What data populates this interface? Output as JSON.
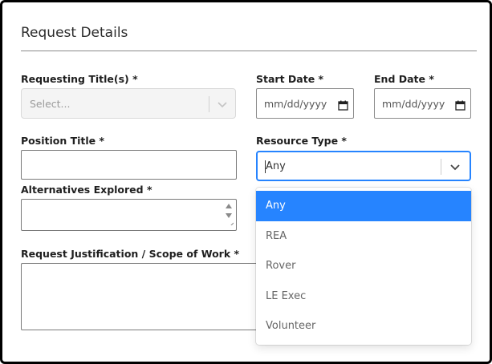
{
  "section": {
    "title": "Request Details"
  },
  "fields": {
    "requesting_titles": {
      "label": "Requesting Title(s) *",
      "placeholder": "Select..."
    },
    "start_date": {
      "label": "Start Date *",
      "placeholder": "mm/dd/yyyy"
    },
    "end_date": {
      "label": "End Date *",
      "placeholder": "mm/dd/yyyy"
    },
    "position_title": {
      "label": "Position Title *",
      "value": ""
    },
    "resource_type": {
      "label": "Resource Type *",
      "value": "Any"
    },
    "alternatives_explored": {
      "label": "Alternatives Explored *",
      "value": ""
    },
    "justification": {
      "label": "Request Justification / Scope of Work *",
      "value": ""
    }
  },
  "resource_type_menu": {
    "options": [
      "Any",
      "REA",
      "Rover",
      "LE Exec",
      "Volunteer"
    ],
    "selected": "Any"
  },
  "icons": {
    "requesting_titles_chevron": "chevron-down-icon",
    "resource_type_chevron": "chevron-down-icon",
    "date_picker": "calendar-icon",
    "spin_up": "arrow-up-icon",
    "spin_down": "arrow-down-icon"
  },
  "colors": {
    "accent": "#2684ff",
    "selected_option_text": "#ffffff"
  }
}
